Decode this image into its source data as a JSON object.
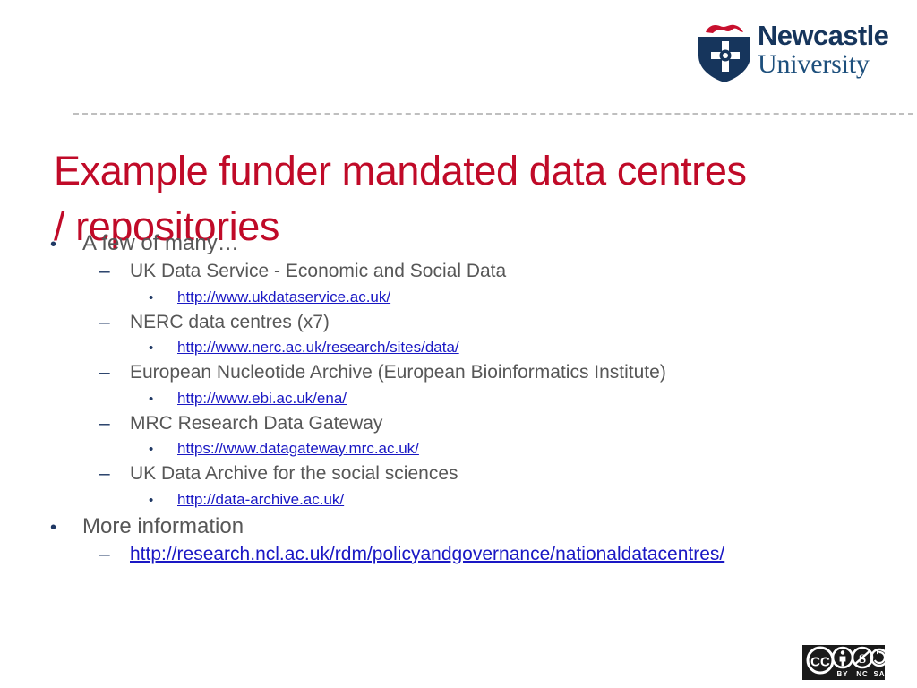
{
  "logo": {
    "name": "Newcastle University",
    "line1": "Newcastle",
    "line2": "University",
    "shield_navy": "#16355c",
    "lion_red": "#c8102e"
  },
  "slide": {
    "title": "Example funder mandated data centres / repositories",
    "title_color": "#c00a28",
    "body_color": "#575757",
    "bullet_color": "#1f3864",
    "link_color": "#1a18c4",
    "divider_color": "#bfbfbf"
  },
  "bullets": {
    "dot": "•",
    "dash": "–"
  },
  "content": [
    {
      "level": 1,
      "text": "A few of many…",
      "is_link": false
    },
    {
      "level": 2,
      "text": "UK Data Service - Economic and Social Data",
      "is_link": false
    },
    {
      "level": 3,
      "text": "http://www.ukdataservice.ac.uk/",
      "is_link": true
    },
    {
      "level": 2,
      "text": "NERC data centres (x7)",
      "is_link": false
    },
    {
      "level": 3,
      "text": "http://www.nerc.ac.uk/research/sites/data/",
      "is_link": true
    },
    {
      "level": 2,
      "text": "European Nucleotide Archive (European Bioinformatics Institute)",
      "is_link": false
    },
    {
      "level": 3,
      "text": "http://www.ebi.ac.uk/ena/",
      "is_link": true
    },
    {
      "level": 2,
      "text": "MRC Research Data Gateway",
      "is_link": false
    },
    {
      "level": 3,
      "text": "https://www.datagateway.mrc.ac.uk/",
      "is_link": true
    },
    {
      "level": 2,
      "text": "UK Data Archive for the social sciences",
      "is_link": false
    },
    {
      "level": 3,
      "text": "http://data-archive.ac.uk/",
      "is_link": true
    },
    {
      "level": 1,
      "text": "More information",
      "is_link": false
    },
    {
      "level": 2,
      "text": "http://research.ncl.ac.uk/rdm/policyandgovernance/nationaldatacentres/",
      "is_link": true
    }
  ],
  "license": {
    "name": "Creative Commons BY-NC-SA",
    "mark": "CC",
    "terms": [
      "BY",
      "NC",
      "SA"
    ]
  }
}
